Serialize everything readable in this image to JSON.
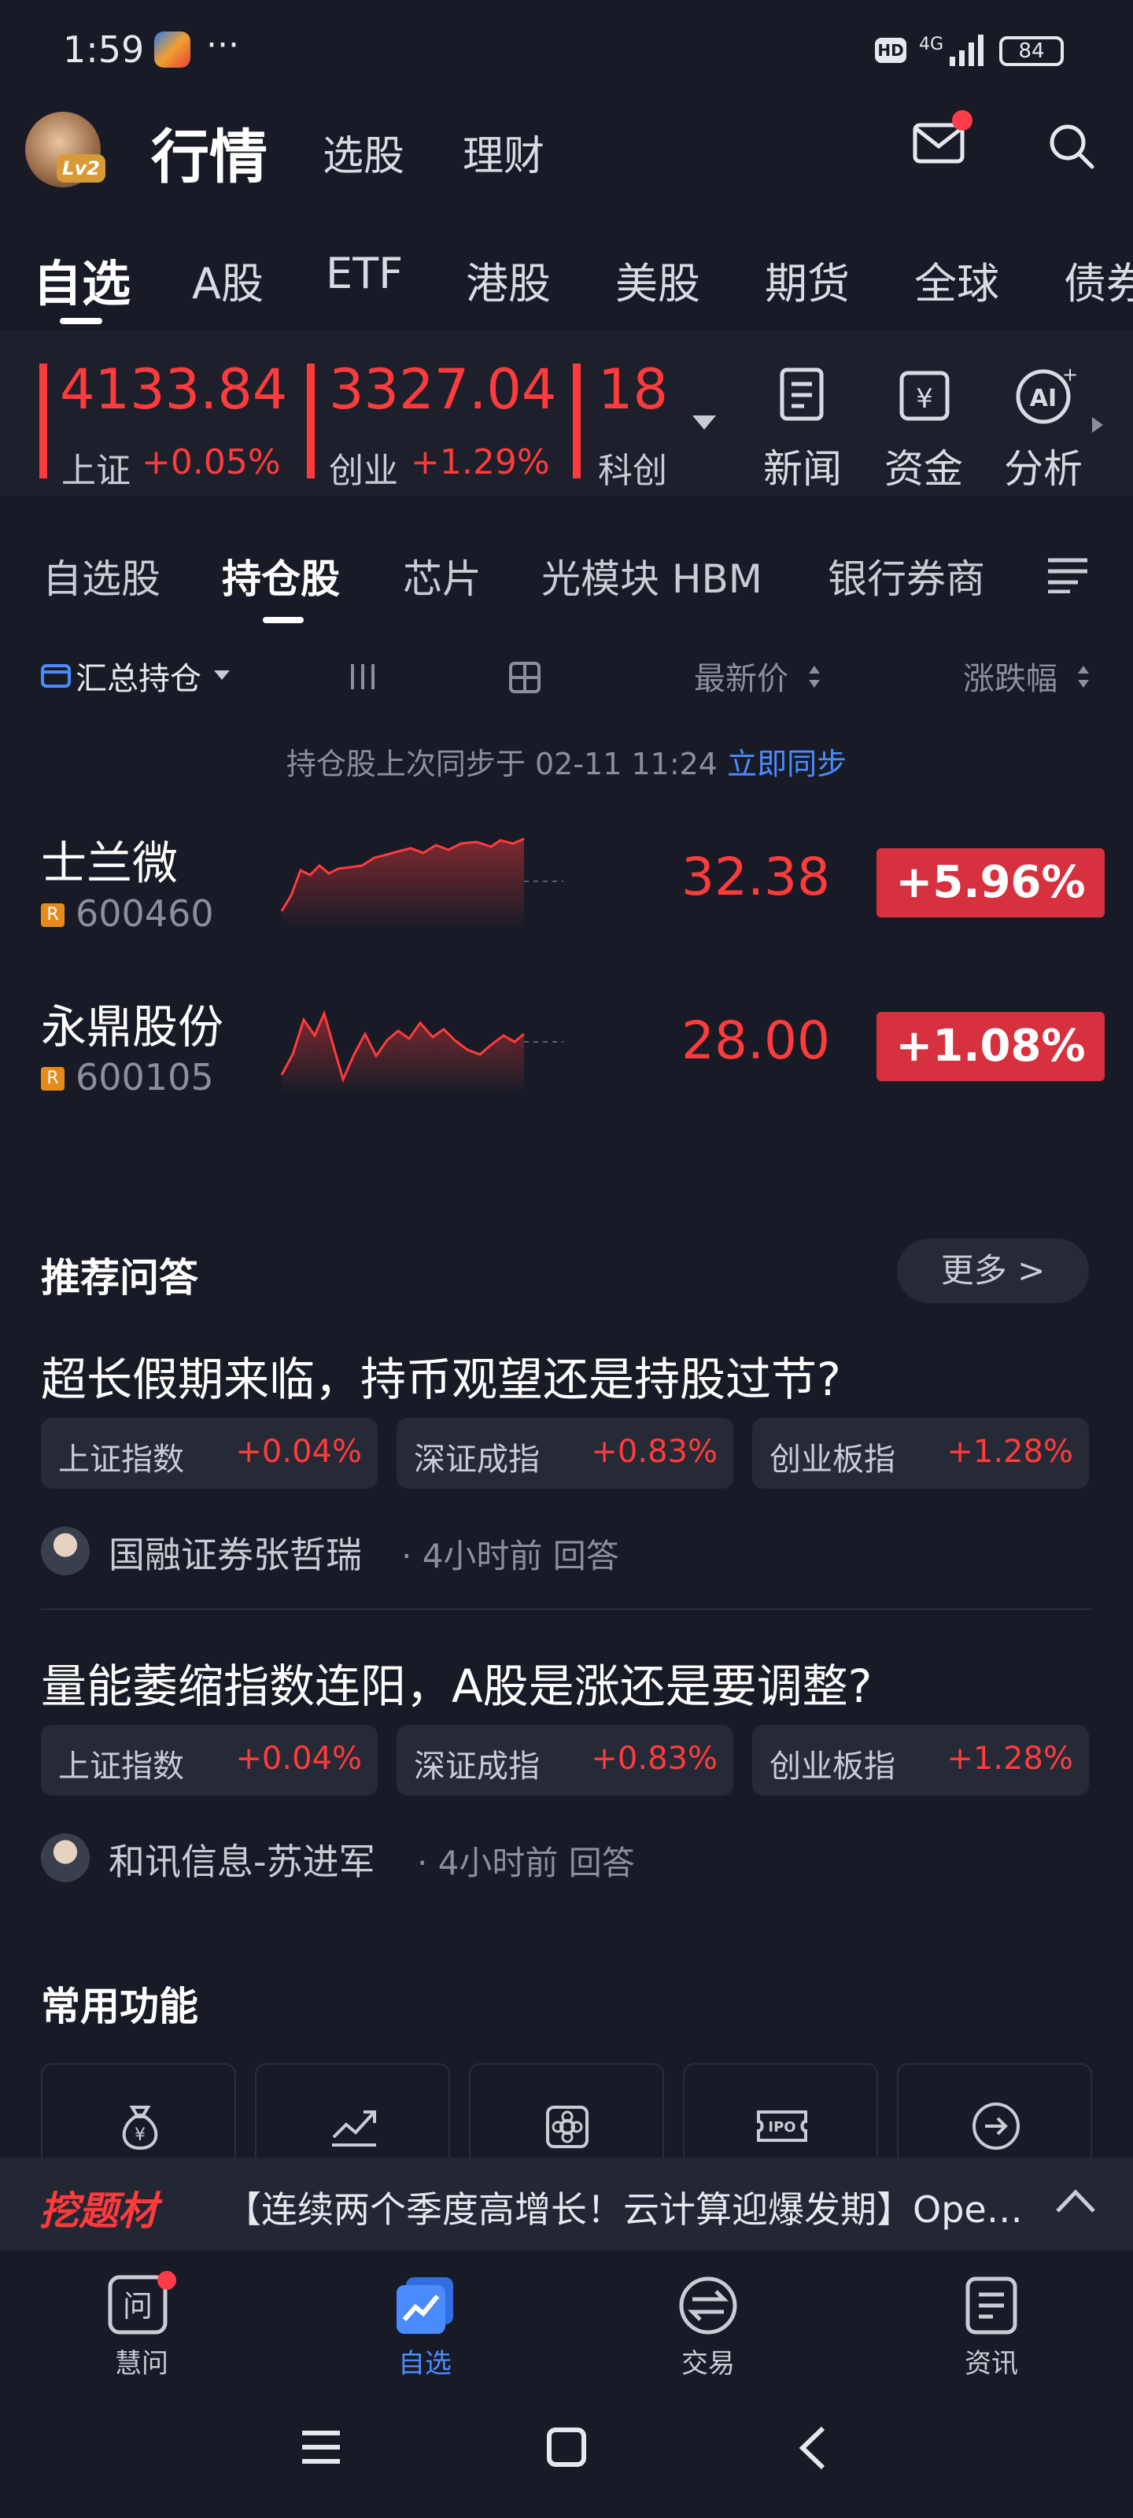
{
  "status_bar": {
    "time": "1:59",
    "dots": "···",
    "hd": "HD",
    "network": "4G",
    "battery": "84"
  },
  "header": {
    "title": "行情",
    "nav": [
      "选股",
      "理财"
    ],
    "level": "Lv2"
  },
  "market_tabs": [
    "自选",
    "A股",
    "ETF",
    "港股",
    "美股",
    "期货",
    "全球",
    "债券"
  ],
  "indices": [
    {
      "value": "4133.84",
      "name": "上证",
      "change": "+0.05%"
    },
    {
      "value": "3327.04",
      "name": "创业",
      "change": "+1.29%"
    },
    {
      "value": "18",
      "name": "科创",
      "change": ""
    }
  ],
  "tools": [
    "新闻",
    "资金",
    "分析"
  ],
  "watch_tabs": [
    "自选股",
    "持仓股",
    "芯片",
    "光模块 HBM",
    "银行券商"
  ],
  "columns": {
    "group": "汇总持仓",
    "price": "最新价",
    "change": "涨跌幅"
  },
  "sync": {
    "text": "持仓股上次同步于 02-11 11:24",
    "link": "立即同步"
  },
  "stocks": [
    {
      "name": "士兰微",
      "code": "600460",
      "badge": "R",
      "price": "32.38",
      "change": "+5.96%"
    },
    {
      "name": "永鼎股份",
      "code": "600105",
      "badge": "R",
      "price": "28.00",
      "change": "+1.08%"
    }
  ],
  "qa": {
    "title": "推荐问答",
    "more": "更多 >",
    "items": [
      {
        "question": "超长假期来临，持币观望还是持股过节?",
        "chips": [
          {
            "label": "上证指数",
            "value": "+0.04%"
          },
          {
            "label": "深证成指",
            "value": "+0.83%"
          },
          {
            "label": "创业板指",
            "value": "+1.28%"
          }
        ],
        "author": "国融证券张哲瑞",
        "meta": "· 4小时前 回答"
      },
      {
        "question": "量能萎缩指数连阳，A股是涨还是要调整?",
        "chips": [
          {
            "label": "上证指数",
            "value": "+0.04%"
          },
          {
            "label": "深证成指",
            "value": "+0.83%"
          },
          {
            "label": "创业板指",
            "value": "+1.28%"
          }
        ],
        "author": "和讯信息-苏进军",
        "meta": "· 4小时前 回答"
      }
    ]
  },
  "features": {
    "title": "常用功能",
    "icons": [
      "money-bag-icon",
      "trend-chart-icon",
      "flower-badge-icon",
      "ipo-ticket-icon",
      "arrow-right-circle-icon"
    ]
  },
  "banner": {
    "tag": "挖题材",
    "text": "【连续两个季度高增长！云计算迎爆发期】OpenAI..."
  },
  "tabbar": [
    "慧问",
    "自选",
    "交易",
    "资讯"
  ],
  "colors": {
    "background": "#181b26",
    "up_red": "#ff3b3b",
    "badge_red": "#d7303e",
    "link_blue": "#4a8cff"
  }
}
